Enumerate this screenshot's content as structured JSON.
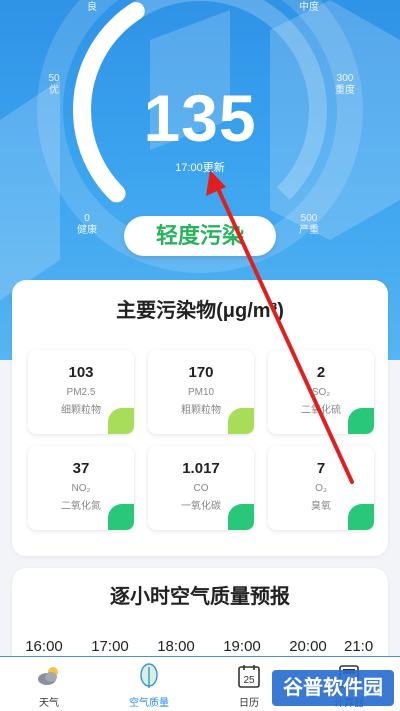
{
  "aqi": {
    "value": "135",
    "update_time": "17:00更新",
    "status": "轻度污染"
  },
  "gauge_scale": {
    "top_left": "良",
    "top_right": "中度",
    "left_num": "50",
    "left_text": "优",
    "right_num": "300",
    "right_text": "重度",
    "bottom_left_num": "0",
    "bottom_left_text": "健康",
    "bottom_right_num": "500",
    "bottom_right_text": "严重"
  },
  "pollutants": {
    "title": "主要污染物(μg/m³)",
    "items": [
      {
        "value": "103",
        "code": "PM2.5",
        "name": "细颗粒物",
        "leaf_color": "#a8dd5a"
      },
      {
        "value": "170",
        "code": "PM10",
        "name": "粗颗粒物",
        "leaf_color": "#a8dd5a"
      },
      {
        "value": "2",
        "code": "SO₂",
        "name": "二氧化硫",
        "leaf_color": "#28c77a"
      },
      {
        "value": "37",
        "code": "NO₂",
        "name": "二氧化氮",
        "leaf_color": "#28c77a"
      },
      {
        "value": "1.017",
        "code": "CO",
        "name": "一氧化碳",
        "leaf_color": "#28c77a"
      },
      {
        "value": "7",
        "code": "O₃",
        "name": "臭氧",
        "leaf_color": "#28c77a"
      }
    ]
  },
  "forecast": {
    "title": "逐小时空气质量预报",
    "hours": [
      "16:00",
      "17:00",
      "18:00",
      "19:00",
      "20:00",
      "21:0"
    ]
  },
  "nav": {
    "items": [
      {
        "label": "天气",
        "icon": "cloud-sun-icon"
      },
      {
        "label": "空气质量",
        "icon": "leaf-icon"
      },
      {
        "label": "日历",
        "icon": "calendar-icon"
      },
      {
        "label": "计算器",
        "icon": "calculator-icon"
      }
    ],
    "calendar_day": "25"
  },
  "watermark": "谷普软件园",
  "colors": {
    "hero_blue": "#2f93e6",
    "status_green": "#27b35c",
    "nav_active": "#2b8be6",
    "arrow_red": "#e02020"
  }
}
